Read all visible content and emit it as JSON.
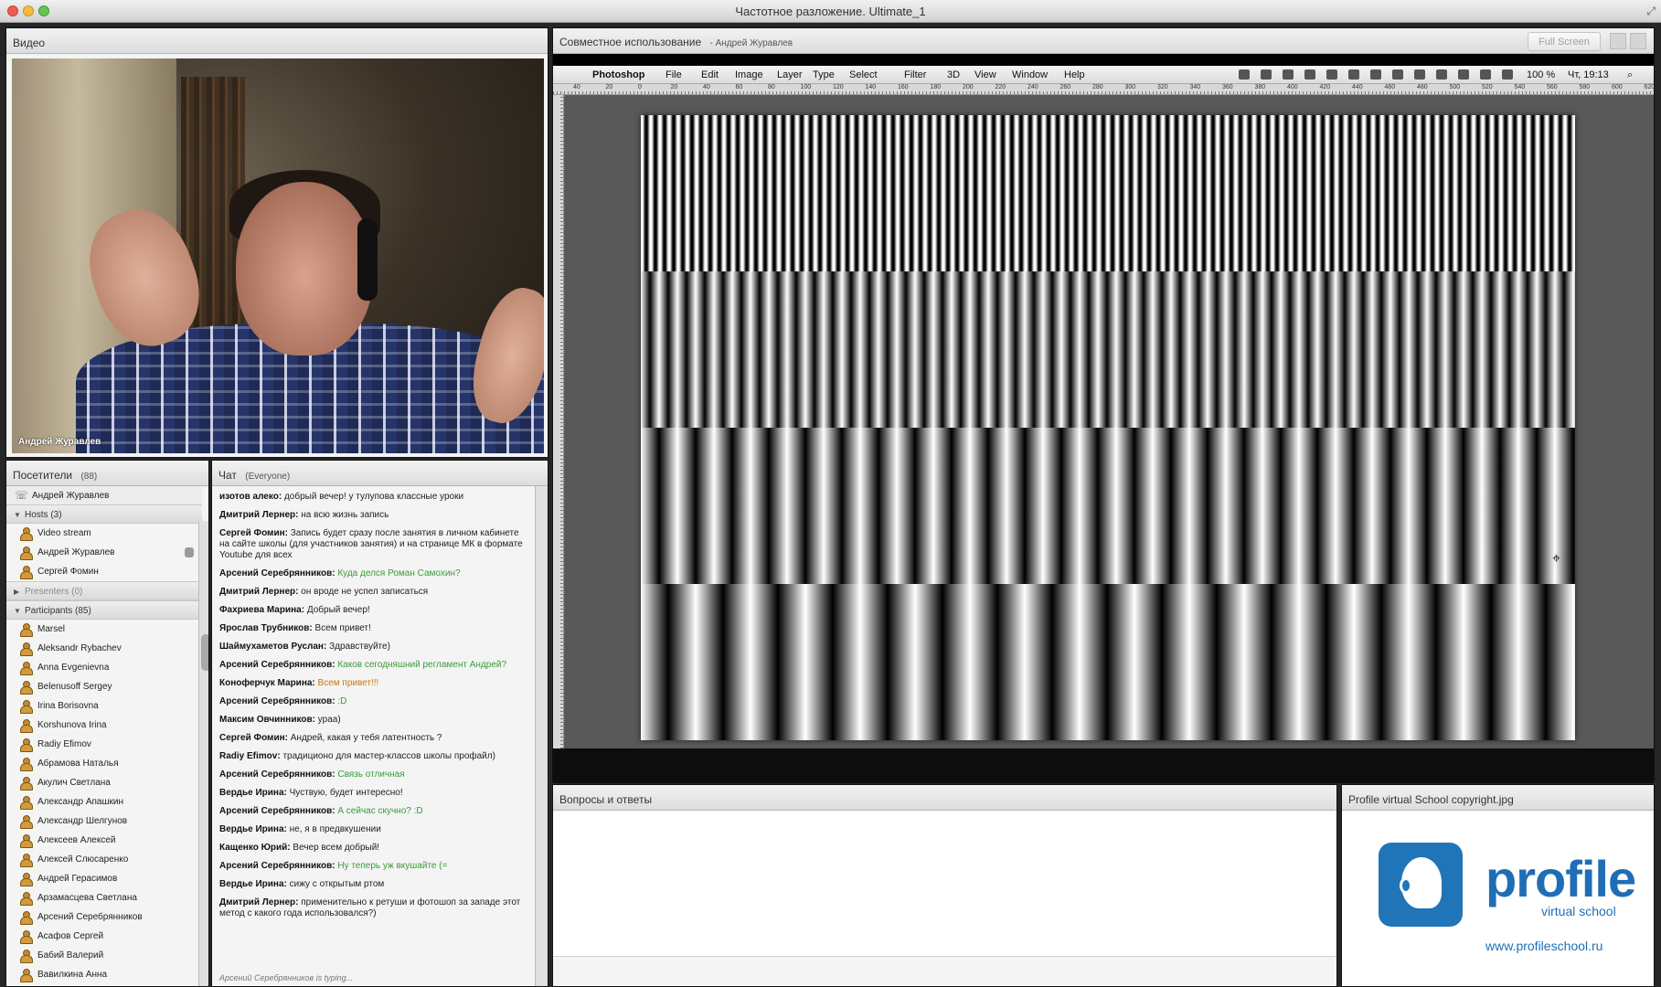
{
  "window": {
    "title": "Частотное разложение. Ultimate_1"
  },
  "video": {
    "title": "Видео",
    "speaker_name": "Андрей Журавлев"
  },
  "attendees": {
    "title": "Посетители",
    "count": "(88)",
    "me": "Андрей Журавлев",
    "hosts_label": "Hosts (3)",
    "hosts": [
      "Video stream",
      "Андрей Журавлев",
      "Сергей Фомин"
    ],
    "presenters_label": "Presenters (0)",
    "participants_label": "Participants (85)",
    "participants": [
      "Marsel",
      "Aleksandr Rybachev",
      "Anna Evgenievna",
      "Belenusoff Sergey",
      "Irina Borisovna",
      "Korshunova Irina",
      "Radiy Efimov",
      "Абрамова Наталья",
      "Акулич Светлана",
      "Александр Апашкин",
      "Александр Шелгунов",
      "Алексеев Алексей",
      "Алексей Слюсаренко",
      "Андрей Герасимов",
      "Арзамасцева Светлана",
      "Арсений Серебрянников",
      "Асафов Сергей",
      "Бабий Валерий",
      "Вавилкина Анна"
    ]
  },
  "chat": {
    "title": "Чат",
    "scope": "(Everyone)",
    "messages": [
      {
        "who": "изотов алеко:",
        "msg": "добрый вечер! у тулупова классные уроки",
        "color": "default"
      },
      {
        "who": "Дмитрий Лернер:",
        "msg": "на всю жизнь запись",
        "color": "default"
      },
      {
        "who": "Сергей Фомин:",
        "msg": "Запись будет сразу после занятия в личном кабинете на сайте школы (для участников занятия) и на странице МК в формате Youtube для всех",
        "color": "default"
      },
      {
        "who": "Арсений Серебрянников:",
        "msg": "Куда делся Роман Самохин?",
        "color": "green"
      },
      {
        "who": "Дмитрий Лернер:",
        "msg": "он вроде не успел записаться",
        "color": "default"
      },
      {
        "who": "Фахриева Марина:",
        "msg": "Добрый вечер!",
        "color": "default"
      },
      {
        "who": "Ярослав Трубников:",
        "msg": "Всем привет!",
        "color": "default"
      },
      {
        "who": "Шаймухаметов Руслан:",
        "msg": "Здравствуйте)",
        "color": "default"
      },
      {
        "who": "Арсений Серебрянников:",
        "msg": "Каков сегодняшний регламент Андрей?",
        "color": "green"
      },
      {
        "who": "Коноферчук Марина:",
        "msg": "Всем привет!!!",
        "color": "orange"
      },
      {
        "who": "Арсений Серебрянников:",
        "msg": ":D",
        "color": "green"
      },
      {
        "who": "Максим Овчинников:",
        "msg": "ураа)",
        "color": "default"
      },
      {
        "who": "Сергей Фомин:",
        "msg": "Андрей, какая у тебя латентность ?",
        "color": "default"
      },
      {
        "who": "Radiy Efimov:",
        "msg": "традиционо для мастер-классов школы профайл)",
        "color": "default"
      },
      {
        "who": "Арсений Серебрянников:",
        "msg": "Связь отличная",
        "color": "green"
      },
      {
        "who": "Вердье Ирина:",
        "msg": "Чуствую, будет интересно!",
        "color": "default"
      },
      {
        "who": "Арсений Серебрянников:",
        "msg": "А сейчас скучно? :D",
        "color": "green"
      },
      {
        "who": "Вердье Ирина:",
        "msg": "не, я в предвкушении",
        "color": "default"
      },
      {
        "who": "Кащенко Юрий:",
        "msg": "Вечер всем добрый!",
        "color": "default"
      },
      {
        "who": "Арсений Серебрянников:",
        "msg": "Ну теперь уж вкушайте (=",
        "color": "green"
      },
      {
        "who": "Вердье Ирина:",
        "msg": "сижу с открытым ртом",
        "color": "default"
      },
      {
        "who": "Дмитрий Лернер:",
        "msg": "применительно к ретуши и фотошоп за западе этот метод с какого года использовался?)",
        "color": "default"
      }
    ],
    "typing": "Арсений Серебрянников is typing..."
  },
  "share": {
    "title": "Совместное использование",
    "presenter": "- Андрей Журавлев",
    "fullscreen_label": "Full Screen",
    "photoshop": {
      "menu": [
        "Photoshop",
        "File",
        "Edit",
        "Image",
        "Layer",
        "Type",
        "Select",
        "Filter",
        "3D",
        "View",
        "Window",
        "Help"
      ],
      "status_zoom": "100 %",
      "status_clock": "Чт, 19:13",
      "ruler_marks": [
        "40",
        "20",
        "0",
        "20",
        "40",
        "60",
        "80",
        "100",
        "120",
        "140",
        "160",
        "180",
        "200",
        "220",
        "240",
        "260",
        "280",
        "300",
        "320",
        "340",
        "360",
        "380",
        "400",
        "420",
        "440",
        "460",
        "480",
        "500",
        "520",
        "540",
        "560",
        "580",
        "600",
        "620"
      ]
    }
  },
  "qa": {
    "title": "Вопросы и ответы"
  },
  "image_pod": {
    "title": "Profile virtual School copyright.jpg",
    "logo_word": "profile",
    "logo_sub": "virtual school",
    "logo_url": "www.profileschool.ru"
  },
  "colors": {
    "accent": "#1f6eb5",
    "chat_green": "#3a9a3a",
    "chat_orange": "#c07a1a"
  }
}
